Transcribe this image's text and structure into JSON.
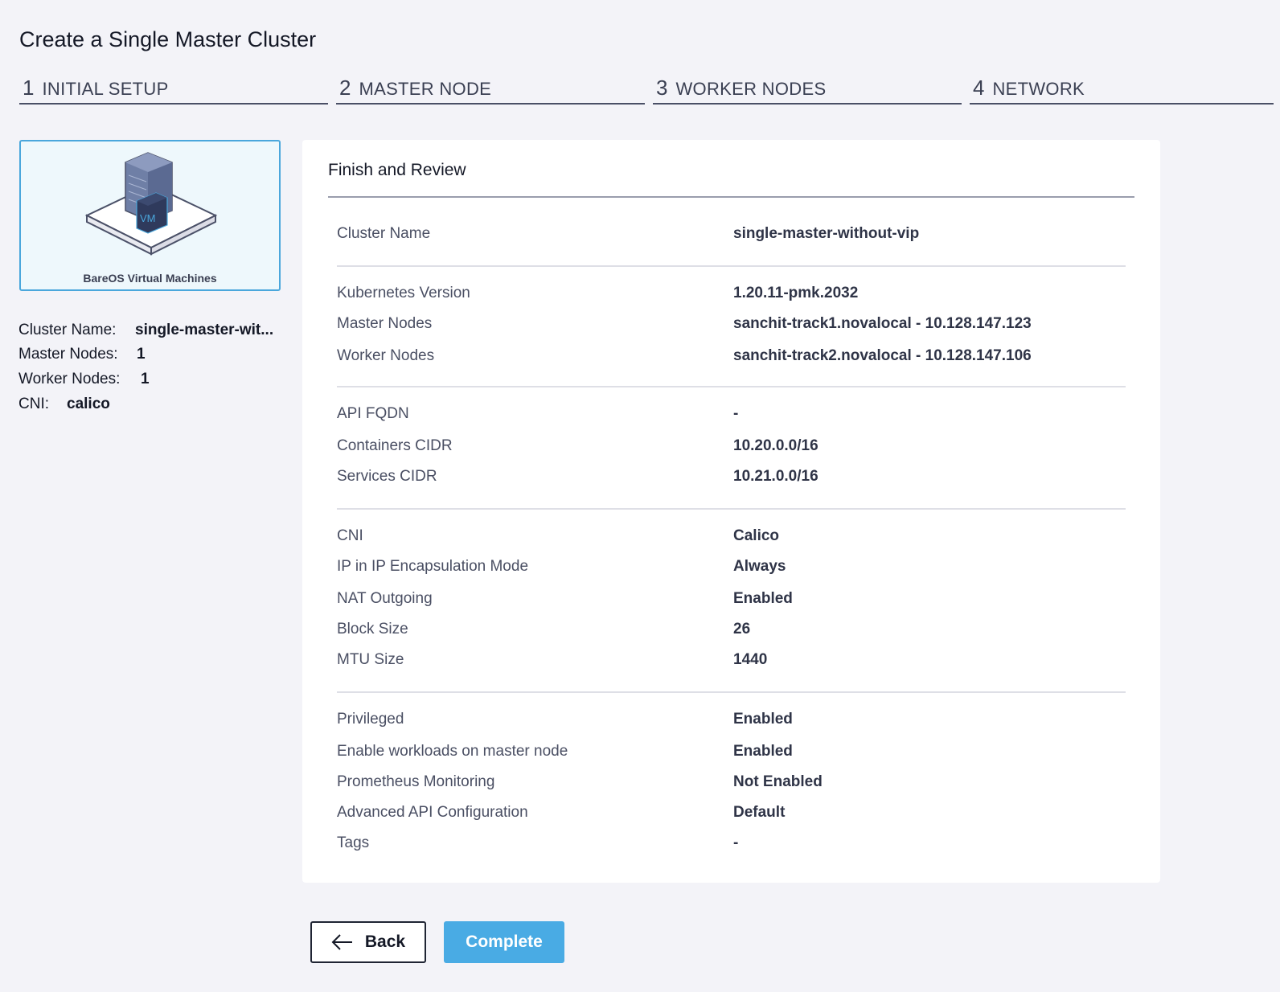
{
  "page": {
    "title": "Create a Single Master Cluster"
  },
  "steps": [
    {
      "num": "1",
      "label": "INITIAL SETUP"
    },
    {
      "num": "2",
      "label": "MASTER NODE"
    },
    {
      "num": "3",
      "label": "WORKER NODES"
    },
    {
      "num": "4",
      "label": "NETWORK"
    }
  ],
  "platform": {
    "label": "BareOS Virtual Machines",
    "icon": "vm-server-icon",
    "badge": "VM"
  },
  "summary": {
    "cluster_name_label": "Cluster Name:",
    "cluster_name_value": "single-master-wit...",
    "master_nodes_label": "Master Nodes:",
    "master_nodes_value": "1",
    "worker_nodes_label": "Worker Nodes:",
    "worker_nodes_value": "1",
    "cni_label": "CNI:",
    "cni_value": "calico"
  },
  "review": {
    "title": "Finish and Review",
    "rows": [
      {
        "label": "Cluster Name",
        "value": "single-master-without-vip"
      },
      {
        "label": "Kubernetes Version",
        "value": "1.20.11-pmk.2032"
      },
      {
        "label": "Master Nodes",
        "value": "sanchit-track1.novalocal - 10.128.147.123"
      },
      {
        "label": "Worker Nodes",
        "value": "sanchit-track2.novalocal - 10.128.147.106"
      },
      {
        "label": "API FQDN",
        "value": "-"
      },
      {
        "label": "Containers CIDR",
        "value": "10.20.0.0/16"
      },
      {
        "label": "Services CIDR",
        "value": "10.21.0.0/16"
      },
      {
        "label": "CNI",
        "value": "Calico"
      },
      {
        "label": "IP in IP Encapsulation Mode",
        "value": "Always"
      },
      {
        "label": "NAT Outgoing",
        "value": "Enabled"
      },
      {
        "label": "Block Size",
        "value": "26"
      },
      {
        "label": "MTU Size",
        "value": "1440"
      },
      {
        "label": "Privileged",
        "value": "Enabled"
      },
      {
        "label": "Enable workloads on master node",
        "value": "Enabled"
      },
      {
        "label": "Prometheus Monitoring",
        "value": "Not Enabled"
      },
      {
        "label": "Advanced API Configuration",
        "value": "Default"
      },
      {
        "label": "Tags",
        "value": "-"
      }
    ]
  },
  "actions": {
    "back_label": "Back",
    "complete_label": "Complete"
  },
  "colors": {
    "accent": "#49abe4",
    "card_border": "#4aa7dc",
    "background": "#f3f3f8"
  }
}
